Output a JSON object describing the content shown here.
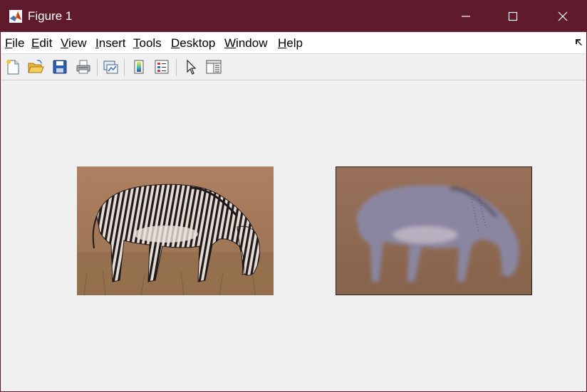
{
  "window": {
    "title": "Figure 1",
    "titlebar_color": "#5f1b2b",
    "icons": {
      "app": "matlab-icon",
      "minimize": "minimize-icon",
      "maximize": "maximize-icon",
      "close": "close-icon"
    }
  },
  "menubar": {
    "items": [
      {
        "pre": "",
        "u": "F",
        "post": "ile"
      },
      {
        "pre": "",
        "u": "E",
        "post": "dit"
      },
      {
        "pre": "",
        "u": "V",
        "post": "iew"
      },
      {
        "pre": "",
        "u": "I",
        "post": "nsert"
      },
      {
        "pre": "",
        "u": "T",
        "post": "ools"
      },
      {
        "pre": "",
        "u": "D",
        "post": "esktop"
      },
      {
        "pre": "",
        "u": "W",
        "post": "indow"
      },
      {
        "pre": "",
        "u": "H",
        "post": "elp"
      }
    ],
    "dock_icon": "dock-arrow-icon"
  },
  "toolbar": {
    "icons": [
      "new-figure-icon",
      "open-file-icon",
      "save-icon",
      "print-icon",
      "link-plot-icon",
      "colorbar-icon",
      "legend-icon",
      "edit-plot-icon",
      "property-inspector-icon"
    ]
  },
  "figure": {
    "left_image": "zebra-original-image",
    "right_image": "zebra-blurred-image",
    "background_color": "#f0f0f0"
  }
}
